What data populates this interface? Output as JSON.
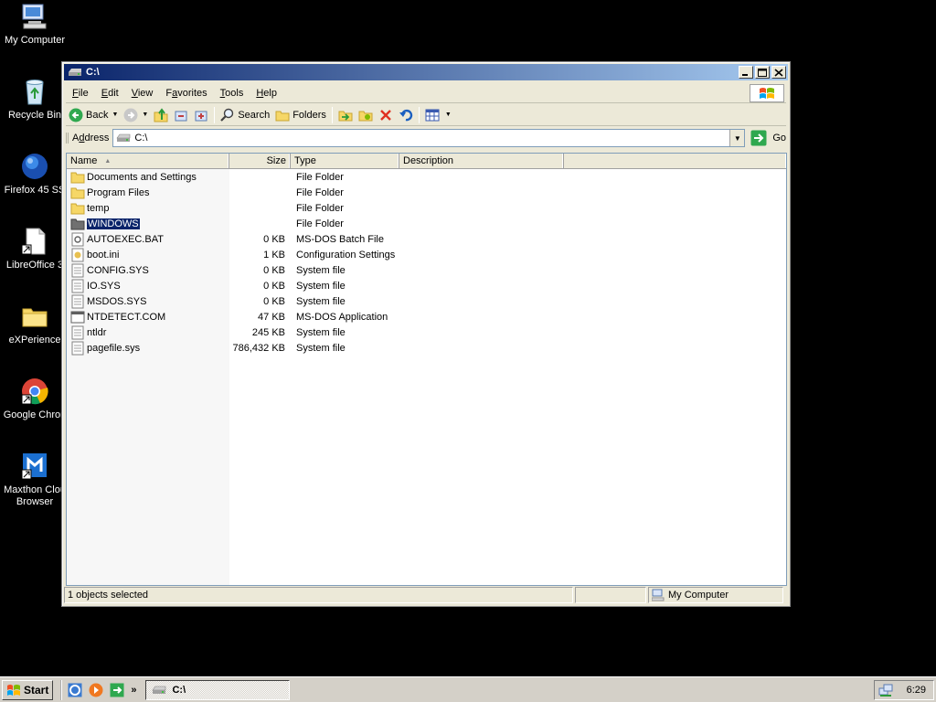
{
  "desktop": {
    "icons": [
      {
        "label": "My Computer",
        "icon": "my-computer-icon"
      },
      {
        "label": "Recycle Bin",
        "icon": "recycle-bin-icon"
      },
      {
        "label": "Firefox 45 SS",
        "icon": "firefox-icon"
      },
      {
        "label": "LibreOffice 3",
        "icon": "libreoffice-icon"
      },
      {
        "label": "eXPerience",
        "icon": "folder-icon"
      },
      {
        "label": "Google Chron",
        "icon": "chrome-icon"
      },
      {
        "label": "Maxthon Clou",
        "label2": "Browser",
        "icon": "maxthon-icon"
      }
    ]
  },
  "window": {
    "title": "C:\\",
    "menu": [
      {
        "key": "F",
        "rest": "ile"
      },
      {
        "key": "E",
        "rest": "dit"
      },
      {
        "key": "V",
        "rest": "iew"
      },
      {
        "key": "",
        "pre": "F",
        "key2": "a",
        "rest": "vorites"
      },
      {
        "key": "T",
        "rest": "ools"
      },
      {
        "key": "H",
        "rest": "elp"
      }
    ],
    "toolbar": {
      "back": "Back",
      "search": "Search",
      "folders": "Folders"
    },
    "address": {
      "label": "Address",
      "label_key": "d",
      "value": "C:\\",
      "go": "Go"
    },
    "columns": {
      "name": "Name",
      "size": "Size",
      "type": "Type",
      "description": "Description"
    },
    "files": [
      {
        "name": "Documents and Settings",
        "size": "",
        "type": "File Folder",
        "icon": "folder-icon"
      },
      {
        "name": "Program Files",
        "size": "",
        "type": "File Folder",
        "icon": "folder-icon"
      },
      {
        "name": "temp",
        "size": "",
        "type": "File Folder",
        "icon": "folder-icon"
      },
      {
        "name": "WINDOWS",
        "size": "",
        "type": "File Folder",
        "icon": "folder-icon",
        "selected": true
      },
      {
        "name": "AUTOEXEC.BAT",
        "size": "0 KB",
        "type": "MS-DOS Batch File",
        "icon": "batch-file-icon"
      },
      {
        "name": "boot.ini",
        "size": "1 KB",
        "type": "Configuration Settings",
        "icon": "config-file-icon"
      },
      {
        "name": "CONFIG.SYS",
        "size": "0 KB",
        "type": "System file",
        "icon": "system-file-icon"
      },
      {
        "name": "IO.SYS",
        "size": "0 KB",
        "type": "System file",
        "icon": "system-file-icon"
      },
      {
        "name": "MSDOS.SYS",
        "size": "0 KB",
        "type": "System file",
        "icon": "system-file-icon"
      },
      {
        "name": "NTDETECT.COM",
        "size": "47 KB",
        "type": "MS-DOS Application",
        "icon": "dos-app-icon"
      },
      {
        "name": "ntldr",
        "size": "245 KB",
        "type": "System file",
        "icon": "system-file-icon"
      },
      {
        "name": "pagefile.sys",
        "size": "786,432 KB",
        "type": "System file",
        "icon": "system-file-icon"
      }
    ],
    "status": {
      "selected": "1 objects selected",
      "zone": "My Computer"
    }
  },
  "taskbar": {
    "start": "Start",
    "task": "C:\\",
    "clock": "6:29"
  },
  "colors": {
    "desktop": "#000000",
    "selection": "#0a246a",
    "face": "#ece9d8"
  }
}
